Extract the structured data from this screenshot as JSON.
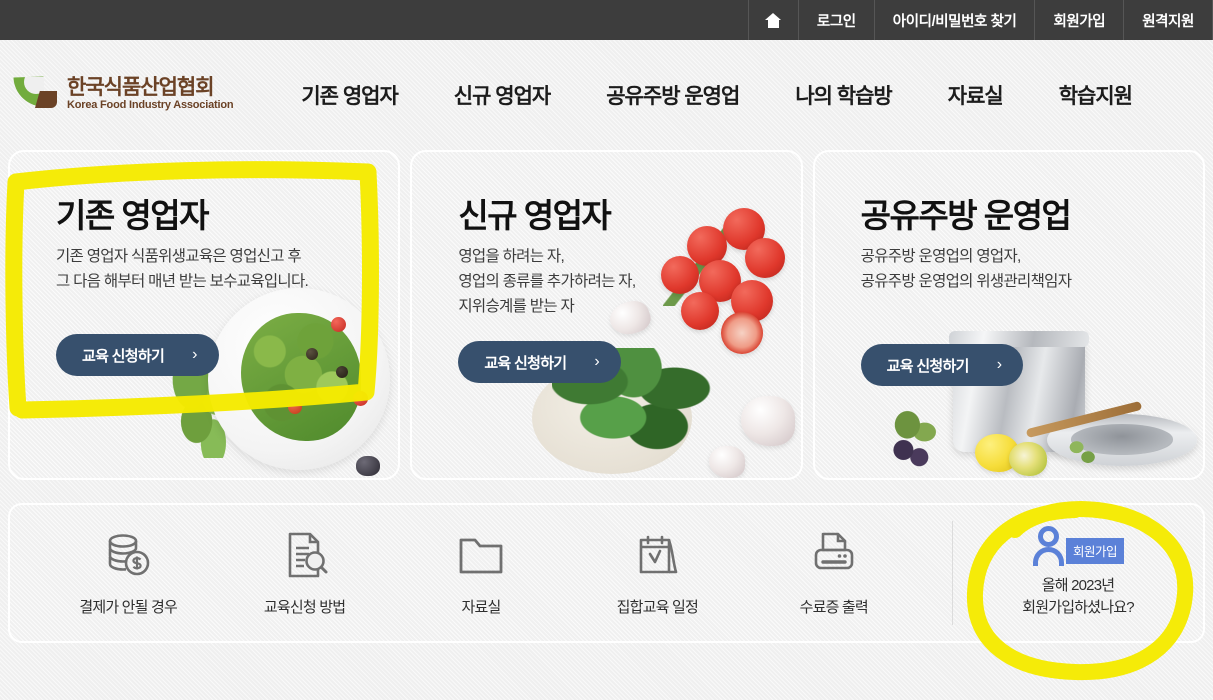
{
  "topbar": {
    "home_icon": "home-icon",
    "items": [
      {
        "label": "로그인",
        "name": "login"
      },
      {
        "label": "아이디/비밀번호 찾기",
        "name": "find-id-password"
      },
      {
        "label": "회원가입",
        "name": "signup"
      },
      {
        "label": "원격지원",
        "name": "remote-support"
      }
    ]
  },
  "header": {
    "logo": {
      "name_ko": "한국식품산업협회",
      "name_en": "Korea Food Industry Association",
      "green": "#72ac3d",
      "brown": "#6b4226"
    },
    "nav": [
      {
        "label": "기존 영업자",
        "name": "existing-operator"
      },
      {
        "label": "신규 영업자",
        "name": "new-operator"
      },
      {
        "label": "공유주방 운영업",
        "name": "shared-kitchen"
      },
      {
        "label": "나의 학습방",
        "name": "my-classroom"
      },
      {
        "label": "자료실",
        "name": "resources"
      },
      {
        "label": "학습지원",
        "name": "learning-support"
      }
    ]
  },
  "cards": [
    {
      "title": "기존 영업자",
      "desc": "기존 영업자 식품위생교육은 영업신고 후\n그 다음 해부터 매년 받는 보수교육입니다.",
      "button": "교육 신청하기",
      "chevron": "›",
      "highlighted": true
    },
    {
      "title": "신규 영업자",
      "desc": "영업을 하려는 자,\n영업의 종류를 추가하려는 자,\n지위승계를 받는 자",
      "button": "교육 신청하기",
      "chevron": "›",
      "highlighted": false
    },
    {
      "title": "공유주방 운영업",
      "desc": "공유주방 운영업의 영업자,\n공유주방 운영업의 위생관리책임자",
      "button": "교육 신청하기",
      "chevron": "›",
      "highlighted": false
    }
  ],
  "quicklinks": [
    {
      "label": "결제가 안될 경우",
      "icon": "coins-dollar-icon"
    },
    {
      "label": "교육신청 방법",
      "icon": "document-search-icon"
    },
    {
      "label": "자료실",
      "icon": "folder-icon"
    },
    {
      "label": "집합교육 일정",
      "icon": "calendar-check-icon"
    },
    {
      "label": "수료증 출력",
      "icon": "printer-icon"
    }
  ],
  "member": {
    "badge": "회원가입",
    "text": "올해 2023년\n회원가입하셨나요?",
    "icon": "person-icon",
    "accent": "#5b81d8",
    "highlighted": true
  },
  "annotation": {
    "color": "#f5ea00",
    "shapes": [
      "card-1-rectangle",
      "member-signup-circle"
    ]
  },
  "colors": {
    "topbar_bg": "#3d3d3d",
    "page_bg": "#efefef",
    "card_bg": "#f0f0f0",
    "button_bg": "#37506d",
    "title_text": "#111111",
    "body_text": "#3c3c3c",
    "highlight_yellow": "#f5ea00",
    "member_blue": "#5b81d8"
  }
}
